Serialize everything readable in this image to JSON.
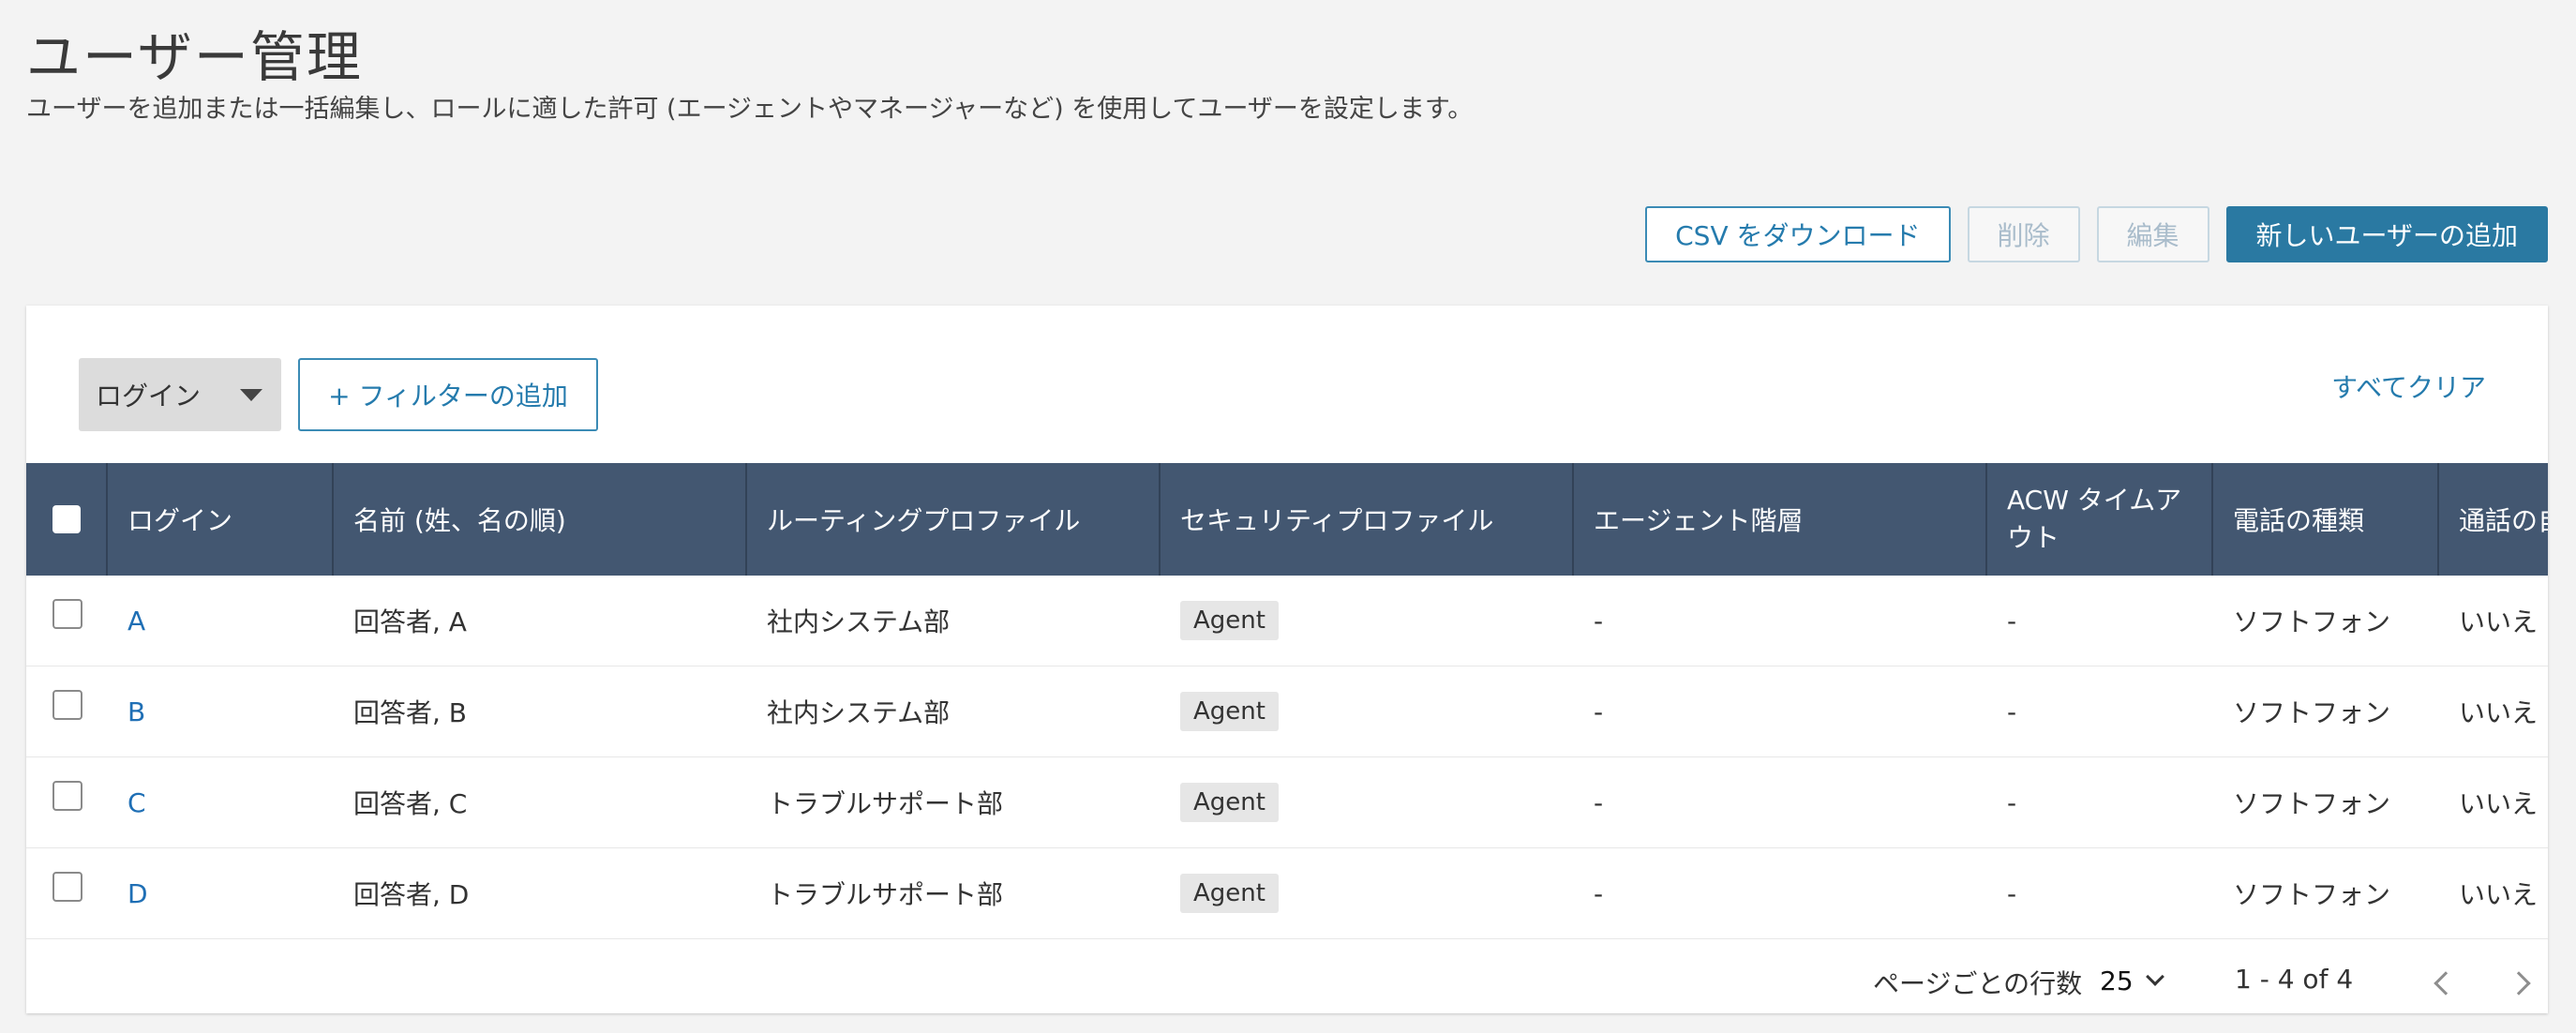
{
  "header": {
    "title": "ユーザー管理",
    "description": "ユーザーを追加または一括編集し、ロールに適した許可 (エージェントやマネージャーなど) を使用してユーザーを設定します。"
  },
  "actions": {
    "download_csv": "CSV をダウンロード",
    "delete": "削除",
    "edit": "編集",
    "add_user": "新しいユーザーの追加"
  },
  "filter": {
    "selected_field": "ログイン",
    "add_filter": "+ フィルターの追加",
    "clear_all": "すべてクリア"
  },
  "table": {
    "columns": [
      "ログイン",
      "名前 (姓、名の順)",
      "ルーティングプロファイル",
      "セキュリティプロファイル",
      "エージェント階層",
      "ACW タイムアウト",
      "電話の種類",
      "通話の自"
    ],
    "rows": [
      {
        "login": "A",
        "name": "回答者, A",
        "routing": "社内システム部",
        "security": "Agent",
        "hierarchy": "-",
        "acw": "-",
        "phone": "ソフトフォン",
        "auto": "いいえ"
      },
      {
        "login": "B",
        "name": "回答者, B",
        "routing": "社内システム部",
        "security": "Agent",
        "hierarchy": "-",
        "acw": "-",
        "phone": "ソフトフォン",
        "auto": "いいえ"
      },
      {
        "login": "C",
        "name": "回答者, C",
        "routing": "トラブルサポート部",
        "security": "Agent",
        "hierarchy": "-",
        "acw": "-",
        "phone": "ソフトフォン",
        "auto": "いいえ"
      },
      {
        "login": "D",
        "name": "回答者, D",
        "routing": "トラブルサポート部",
        "security": "Agent",
        "hierarchy": "-",
        "acw": "-",
        "phone": "ソフトフォン",
        "auto": "いいえ"
      }
    ]
  },
  "pagination": {
    "rows_per_page_label": "ページごとの行数",
    "rows_per_page_value": "25",
    "range": "1 - 4 of 4"
  },
  "icons": {
    "filter_dropdown": "caret-down-icon",
    "rows_per_page": "chevron-down-icon",
    "prev": "chevron-left-icon",
    "next": "chevron-right-icon"
  },
  "colors": {
    "primary": "#2a79a2",
    "table_header": "#435771",
    "link": "#1f6fb5",
    "background": "#f3f3f3"
  }
}
